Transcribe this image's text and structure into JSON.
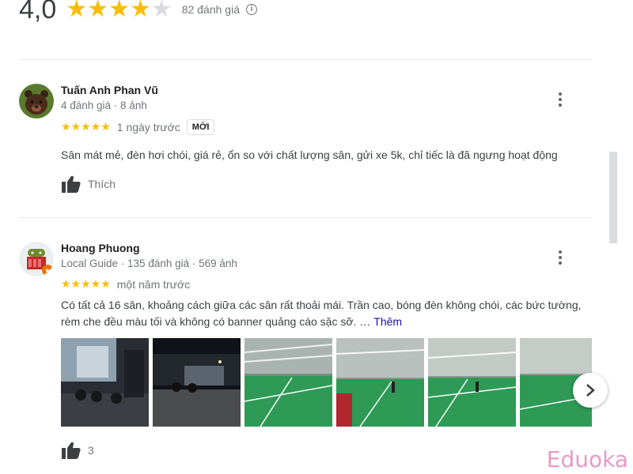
{
  "summary": {
    "score": "4,0",
    "stars_on": 4,
    "stars_total": 5,
    "count_label": "82 đánh giá",
    "info_icon": "info-icon"
  },
  "reviews": [
    {
      "author": "Tuấn Anh Phan Vũ",
      "meta": "4 đánh giá · 8 ảnh",
      "stars": "★★★★★",
      "time": "1 ngày trước",
      "badge": "MỚI",
      "text": "Sân mát mẻ, đèn hơi chói, giá rẻ, ổn so với chất lượng sân, gửi xe 5k, chỉ tiếc là đã ngưng hoạt động",
      "like_label": "Thích",
      "avatar_icon": "bear-avatar"
    },
    {
      "author": "Hoang Phuong",
      "meta": "Local Guide · 135 đánh giá · 569 ảnh",
      "stars": "★★★★★",
      "time": "một năm trước",
      "text": "Có tất cả 16 sân, khoảng cách giữa các sân rất thoải mái. Trần cao, bóng đèn không chói, các bức tường, rèm che đều màu tối và không có banner quảng cáo sặc sỡ. …",
      "more_label": "Thêm",
      "like_count": "3",
      "avatar_icon": "android-avatar"
    }
  ],
  "watermark": "Eduoka",
  "colors": {
    "star": "#fbbc04",
    "court_green": "#2e9a56",
    "link": "#1a0dab"
  }
}
